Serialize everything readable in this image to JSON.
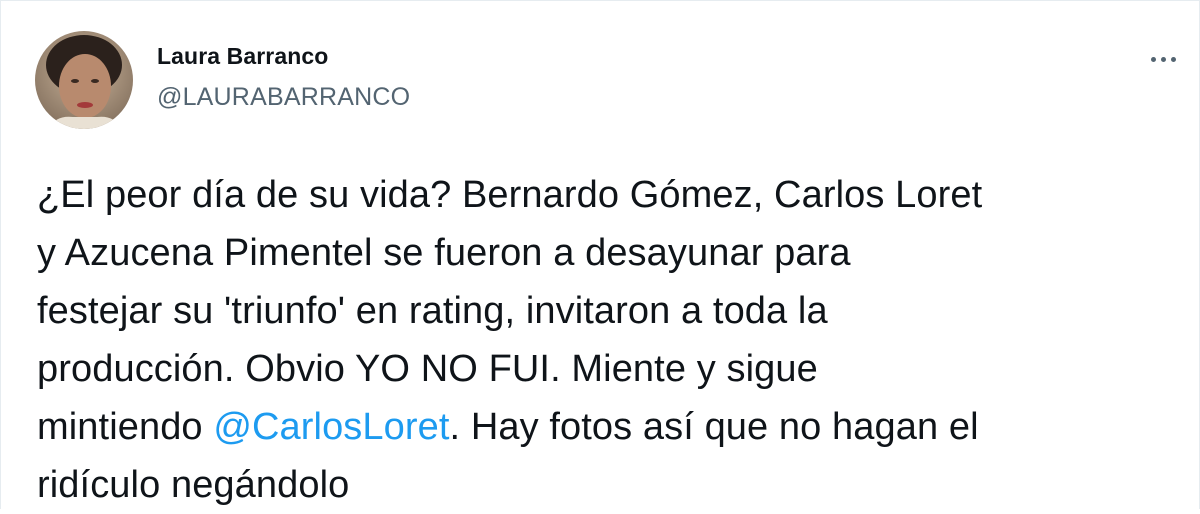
{
  "author": {
    "name": "Laura Barranco",
    "handle": "@LAURABARRANCO",
    "avatar_icon": "profile-photo"
  },
  "more_icon": "more-options-icon",
  "tweet": {
    "lines": [
      {
        "before": "¿El peor día de su vida? Bernardo Gómez, Carlos Loret"
      },
      {
        "before": "y Azucena Pimentel se fueron a desayunar para"
      },
      {
        "before": "festejar su 'triunfo' en rating, invitaron a toda la"
      },
      {
        "before": "producción. Obvio YO NO FUI. Miente y sigue"
      },
      {
        "before": "mintiendo ",
        "mention": "@CarlosLoret",
        "after": ". Hay fotos así que no hagan el"
      },
      {
        "before": "ridículo negándolo"
      }
    ]
  },
  "colors": {
    "text": "#0f1419",
    "secondary": "#536471",
    "link": "#1d9bf0"
  }
}
